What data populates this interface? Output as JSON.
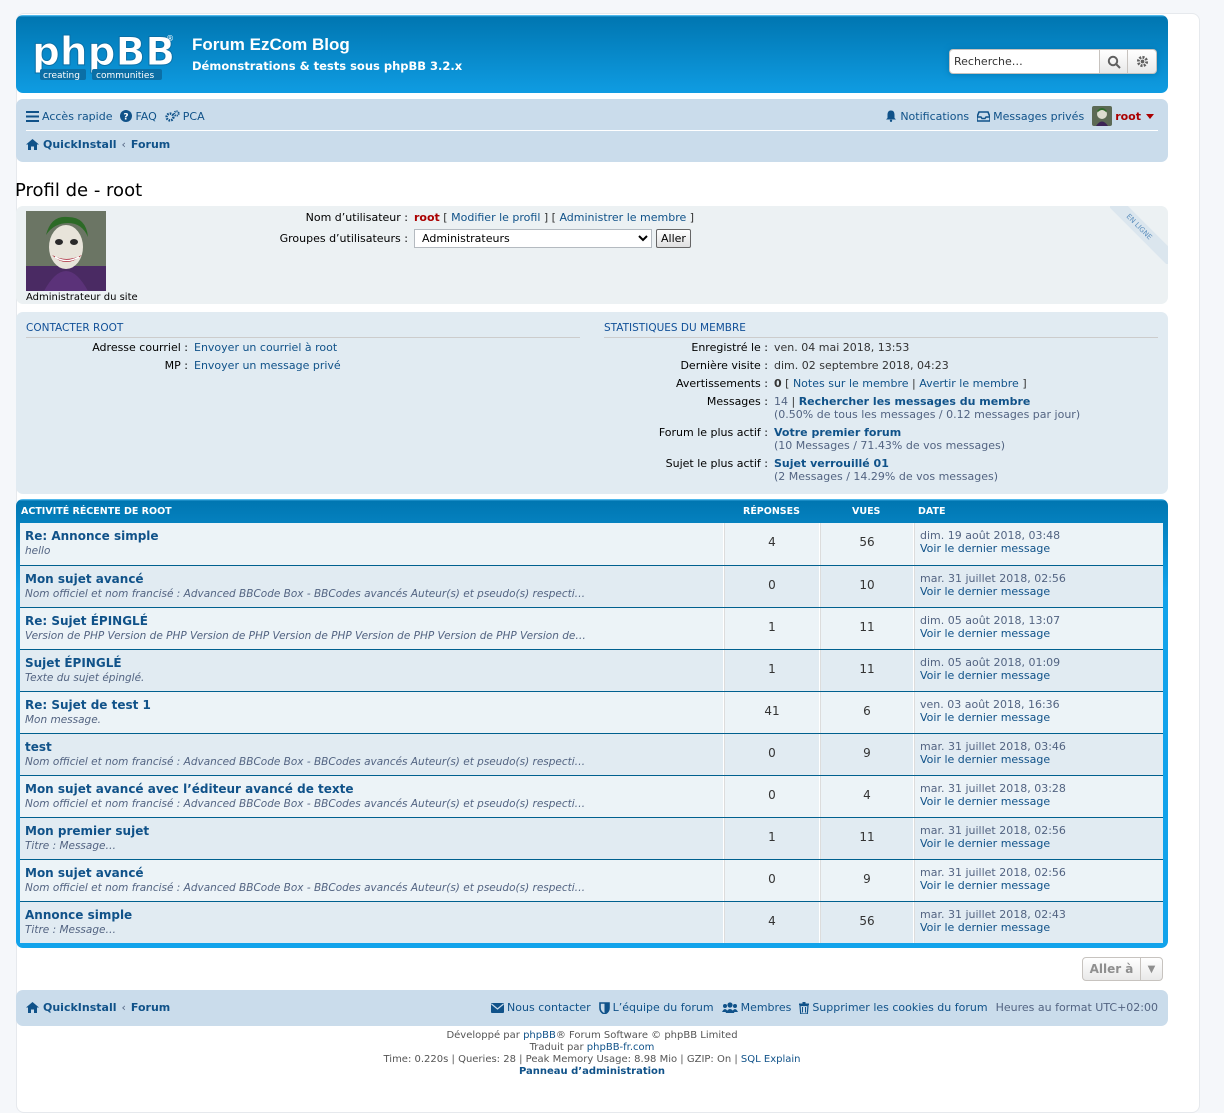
{
  "header": {
    "logo_text": "phpBB",
    "logo_tagline_left": "creating",
    "logo_tagline_right": "communities",
    "site_title": "Forum EzCom Blog",
    "site_description": "Démonstrations & tests sous phpBB 3.2.x",
    "search_placeholder": "Recherche…"
  },
  "nav": {
    "quick_access": "Accès rapide",
    "faq": "FAQ",
    "acp": "PCA",
    "notifications": "Notifications",
    "private_messages": "Messages privés",
    "username": "root"
  },
  "breadcrumb": {
    "home": "QuickInstall",
    "forum": "Forum"
  },
  "page_title": "Profil de - root",
  "profile": {
    "online_ribbon": "EN LIGNE",
    "rank": "Administrateur du site",
    "username_label": "Nom d’utilisateur :",
    "username": "root",
    "edit_profile": "Modifier le profil",
    "admin_user": "Administrer le membre",
    "groups_label": "Groupes d’utilisateurs :",
    "group_selected": "Administrateurs",
    "go_button": "Aller"
  },
  "contact": {
    "heading": "CONTACTER ROOT",
    "email_label": "Adresse courriel :",
    "email_link": "Envoyer un courriel à root",
    "pm_label": "MP :",
    "pm_link": "Envoyer un message privé"
  },
  "stats": {
    "heading": "STATISTIQUES DU MEMBRE",
    "registered_label": "Enregistré le :",
    "registered": "ven. 04 mai 2018, 13:53",
    "last_visit_label": "Dernière visite :",
    "last_visit": "dim. 02 septembre 2018, 04:23",
    "warnings_label": "Avertissements :",
    "warnings": "0",
    "notes_link": "Notes sur le membre",
    "warn_link": "Avertir le membre",
    "posts_label": "Messages :",
    "posts": "14",
    "search_posts": "Rechercher les messages du membre",
    "posts_detail": "(0.50% de tous les messages / 0.12 messages par jour)",
    "active_forum_label": "Forum le plus actif :",
    "active_forum": "Votre premier forum",
    "active_forum_detail": "(10 Messages / 71.43% de vos messages)",
    "active_topic_label": "Sujet le plus actif :",
    "active_topic": "Sujet verrouillé 01",
    "active_topic_detail": "(2 Messages / 14.29% de vos messages)"
  },
  "activity": {
    "heading": "ACTIVITÉ RÉCENTE DE ROOT",
    "col_replies": "RÉPONSES",
    "col_views": "VUES",
    "col_date": "DATE",
    "last_post_link": "Voir le dernier message",
    "rows": [
      {
        "title": "Re: Annonce simple",
        "excerpt": "hello",
        "replies": "4",
        "views": "56",
        "date": "dim. 19 août 2018, 03:48"
      },
      {
        "title": "Mon sujet avancé",
        "excerpt": "Nom officiel et nom francisé : Advanced BBCode Box - BBCodes avancés Auteur(s) et pseudo(s) respecti…",
        "replies": "0",
        "views": "10",
        "date": "mar. 31 juillet 2018, 02:56"
      },
      {
        "title": "Re: Sujet ÉPINGLÉ",
        "excerpt": "Version de PHP Version de PHP Version de PHP Version de PHP Version de PHP Version de PHP Version de…",
        "replies": "1",
        "views": "11",
        "date": "dim. 05 août 2018, 13:07"
      },
      {
        "title": "Sujet ÉPINGLÉ",
        "excerpt": "Texte du sujet épinglé.",
        "replies": "1",
        "views": "11",
        "date": "dim. 05 août 2018, 01:09"
      },
      {
        "title": "Re: Sujet de test 1",
        "excerpt": "Mon message.",
        "replies": "41",
        "views": "6",
        "date": "ven. 03 août 2018, 16:36"
      },
      {
        "title": "test",
        "excerpt": "Nom officiel et nom francisé : Advanced BBCode Box - BBCodes avancés Auteur(s) et pseudo(s) respecti…",
        "replies": "0",
        "views": "9",
        "date": "mar. 31 juillet 2018, 03:46"
      },
      {
        "title": "Mon sujet avancé avec l’éditeur avancé de texte",
        "excerpt": "Nom officiel et nom francisé : Advanced BBCode Box - BBCodes avancés Auteur(s) et pseudo(s) respecti…",
        "replies": "0",
        "views": "4",
        "date": "mar. 31 juillet 2018, 03:28"
      },
      {
        "title": "Mon premier sujet",
        "excerpt": "Titre : Message…",
        "replies": "1",
        "views": "11",
        "date": "mar. 31 juillet 2018, 02:56"
      },
      {
        "title": "Mon sujet avancé",
        "excerpt": "Nom officiel et nom francisé : Advanced BBCode Box - BBCodes avancés Auteur(s) et pseudo(s) respecti…",
        "replies": "0",
        "views": "9",
        "date": "mar. 31 juillet 2018, 02:56"
      },
      {
        "title": "Annonce simple",
        "excerpt": "Titre : Message…",
        "replies": "4",
        "views": "56",
        "date": "mar. 31 juillet 2018, 02:43"
      }
    ]
  },
  "jump_to": "Aller à",
  "footer": {
    "contact": "Nous contacter",
    "team": "L’équipe du forum",
    "members": "Membres",
    "delete_cookies": "Supprimer les cookies du forum",
    "timezone": "Heures au format UTC+02:00",
    "powered_prefix": "Développé par ",
    "powered_link": "phpBB",
    "powered_suffix": "® Forum Software © phpBB Limited",
    "translated_prefix": "Traduit par ",
    "translated_link": "phpBB-fr.com",
    "debug": "Time: 0.220s | Queries: 28 | Peak Memory Usage: 8.98 Mio | GZIP: On | ",
    "sql_explain": "SQL Explain",
    "admin_panel": "Panneau d’administration"
  },
  "colors": {
    "header_blue": "#12a3eb",
    "navbar_bg": "#cadceb",
    "link": "#105289",
    "username_red": "#aa0000"
  }
}
